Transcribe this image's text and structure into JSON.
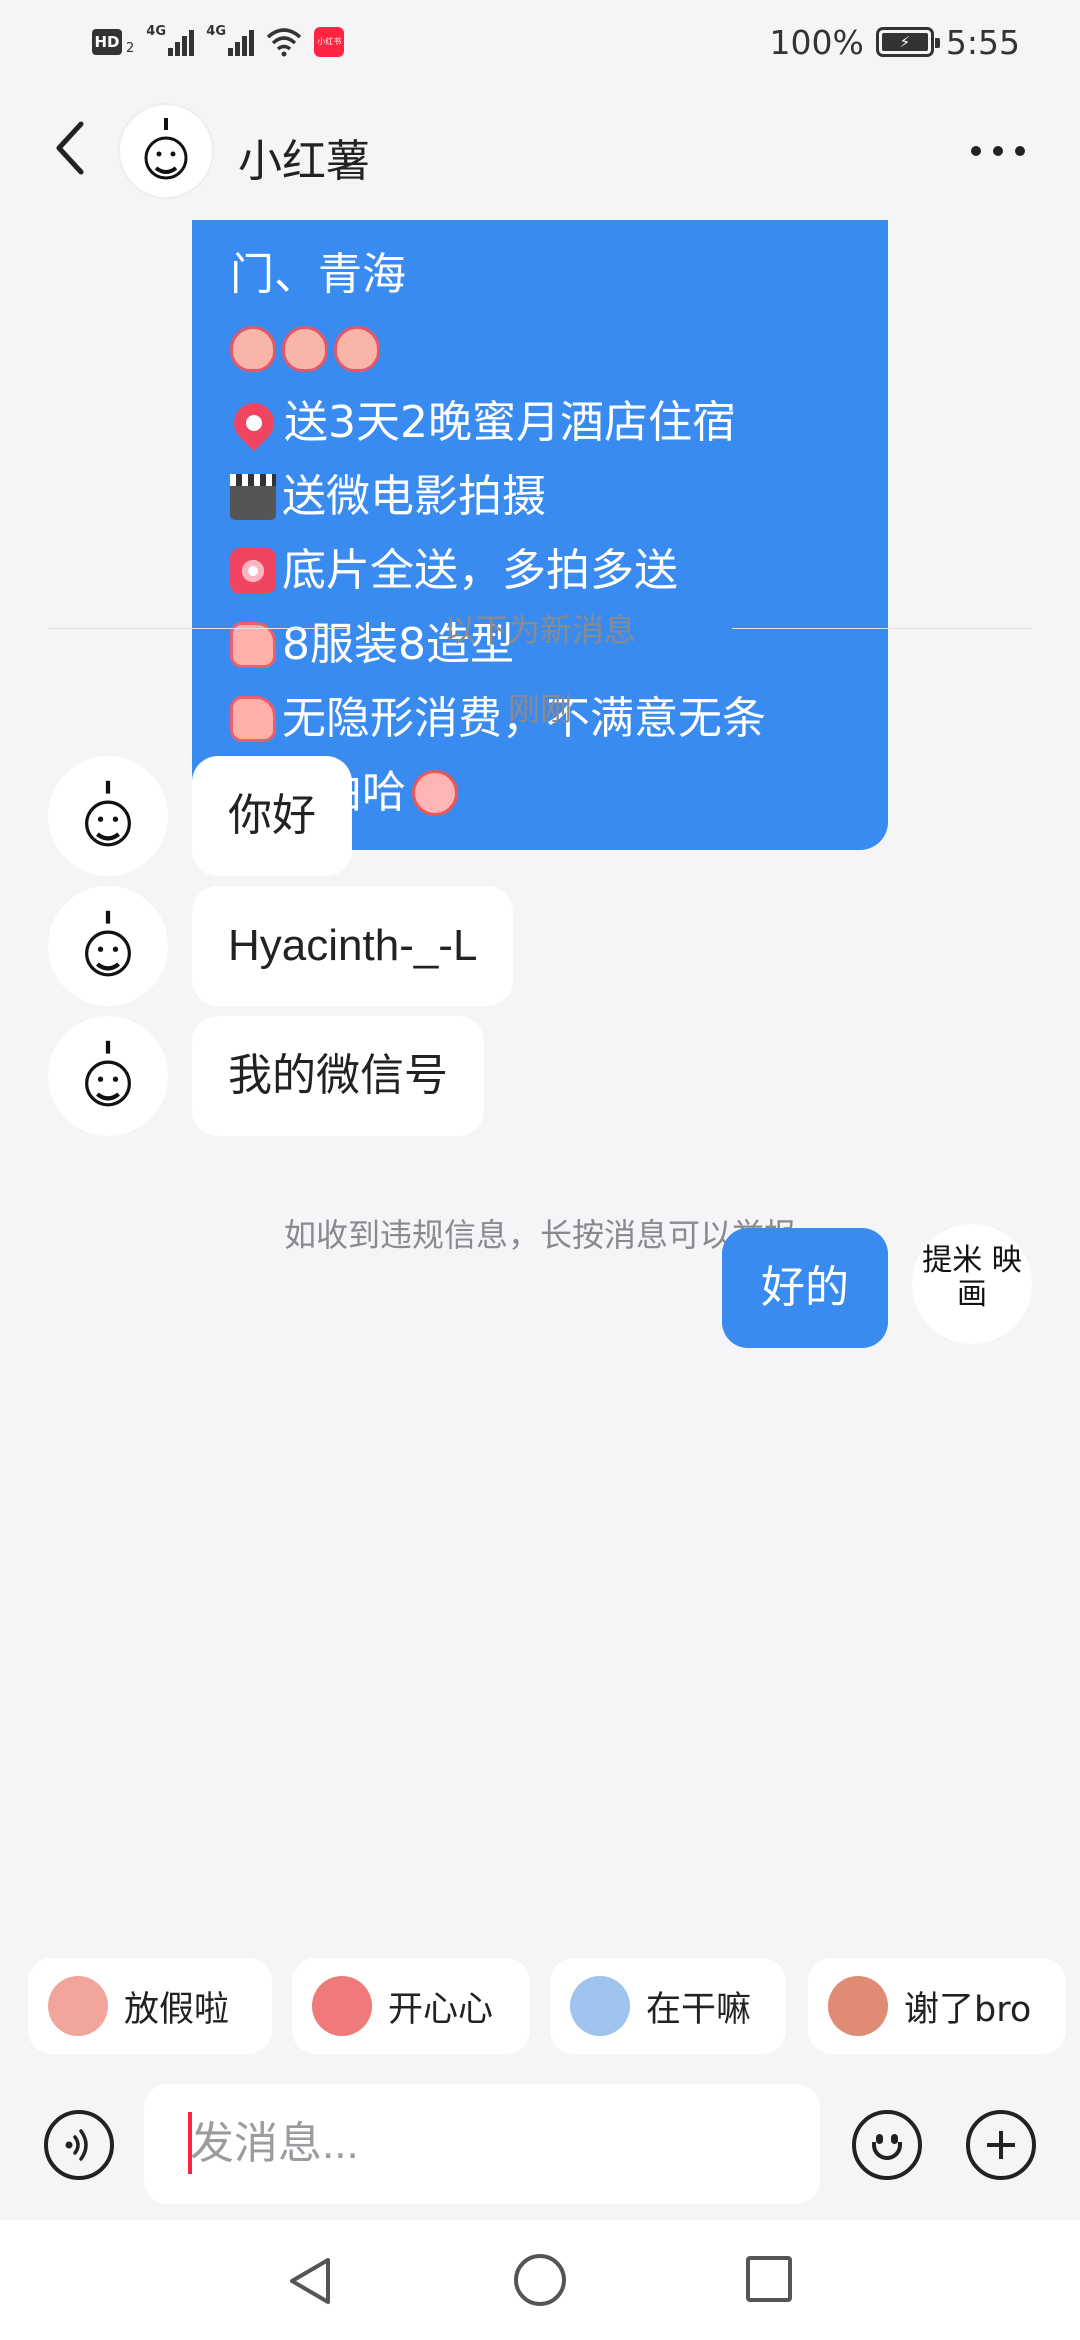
{
  "status_bar": {
    "network_badge": "HD",
    "network_sub": "2",
    "sim1": "4G",
    "sim2": "4G",
    "mini_app_label": "小红书",
    "battery": "100%",
    "time": "5:55"
  },
  "header": {
    "title": "小红薯"
  },
  "chat": {
    "card_lines": [
      "门、青海",
      "",
      "送3天2晚蜜月酒店住宿",
      "送微电影拍摄",
      "底片全送，多拍多送",
      "8服装8造型",
      "无隐形消费，不满意无条",
      "件重拍哈"
    ],
    "card_icons": [
      "clap-emoji",
      "location-pin-emoji",
      "clapperboard-emoji",
      "camera-emoji",
      "thumbs-up-emoji",
      "laughing-face-emoji"
    ],
    "new_messages_divider": "以下为新消息",
    "timestamp": "刚刚",
    "messages": [
      {
        "text": "你好"
      },
      {
        "text": "Hyacinth-_-L"
      },
      {
        "text": "我的微信号"
      }
    ],
    "report_notice": "如收到违规信息，长按消息可以举报",
    "my_message": "好的",
    "my_avatar_text": "提米 映画"
  },
  "quick_replies": [
    {
      "label": "放假啦",
      "color": "#f2a59a"
    },
    {
      "label": "开心心",
      "color": "#f07a7a"
    },
    {
      "label": "在干嘛",
      "color": "#9ec4ee"
    },
    {
      "label": "谢了bro",
      "color": "#e08b73"
    }
  ],
  "input": {
    "placeholder": "发消息..."
  },
  "theme": {
    "accent_blue": "#3a8bf0",
    "brand_red": "#ff2442",
    "background": "#f5f5f7"
  }
}
